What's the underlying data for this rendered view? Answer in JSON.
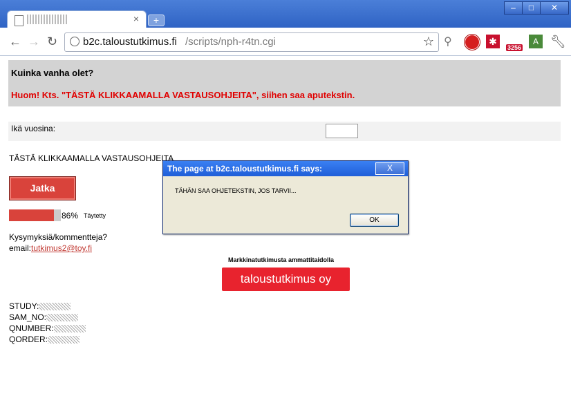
{
  "browser": {
    "tab_title": "",
    "tab_close": "×",
    "new_tab": "+",
    "url_host": "b2c.taloustutkimus.fi",
    "url_path": "/scripts/nph-r4tn.cgi",
    "extension_badge": "3256",
    "minimize": "–",
    "maximize": "□",
    "close": "✕"
  },
  "question": {
    "title": "Kuinka vanha olet?",
    "note": "Huom! Kts. \"TÄSTÄ KLIKKAAMALLA VASTAUSOHJEITA\", siihen saa aputekstin."
  },
  "form": {
    "age_label": "Ikä vuosina:",
    "age_value": ""
  },
  "help_link": "TÄSTÄ KLIKKAAMALLA VASTAUSOHJEITA",
  "next_button": "Jatka",
  "progress": {
    "value": 0.86,
    "percent_text": "86%",
    "label": "Täytetty"
  },
  "contact": {
    "question": "Kysymyksiä/kommentteja?",
    "email_label": "email:",
    "email": "tutkimus2@toy.fi"
  },
  "branding": {
    "tagline": "Markkinatutkimusta ammattitaidolla",
    "logo_text": "taloustutkimus oy"
  },
  "meta_fields": {
    "study": "STUDY:",
    "sam_no": "SAM_NO:",
    "qnumber": "QNUMBER:",
    "qorder": "QORDER:"
  },
  "dialog": {
    "title": "The page at b2c.taloustutkimus.fi says:",
    "message": "TÄHÄN SAA OHJETEKSTIN, JOS TARVII...",
    "ok_label": "OK",
    "close_label": "X"
  }
}
